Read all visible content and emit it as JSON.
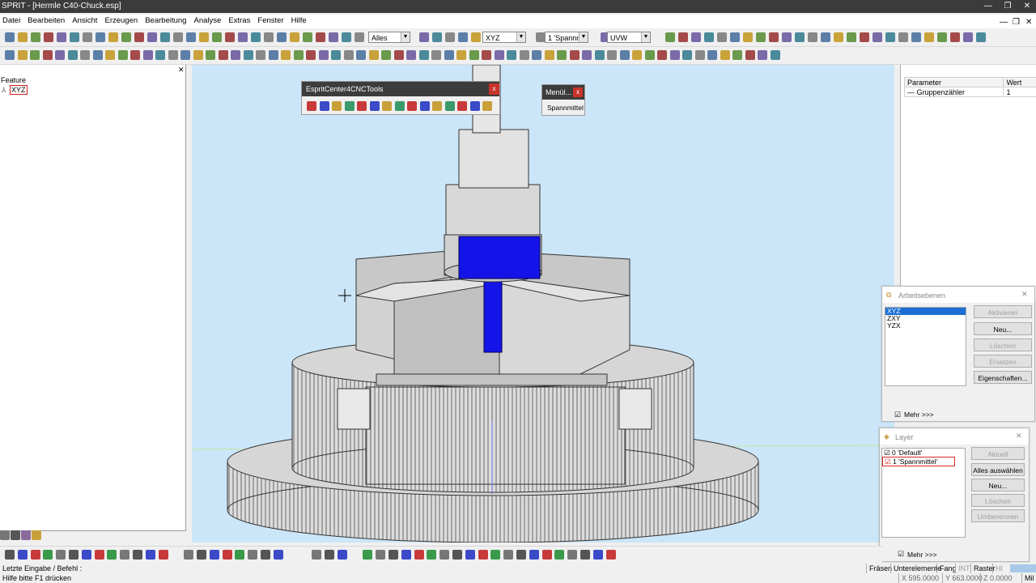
{
  "window": {
    "title": "SPRIT - [Hermle C40-Chuck.esp]",
    "buttons": [
      "—",
      "❐",
      "✕"
    ],
    "mdi_buttons": [
      "—",
      "❐",
      "✕"
    ]
  },
  "menu": [
    "Datei",
    "Bearbeiten",
    "Ansicht",
    "Erzeugen",
    "Bearbeitung",
    "Analyse",
    "Extras",
    "Fenster",
    "Hilfe"
  ],
  "toolbar": {
    "filter_combo": "Alles",
    "plane_combo": "XYZ",
    "layer_combo": "1 'Spannm",
    "uvw_combo": "UVW"
  },
  "feature_panel": {
    "title": "Feature",
    "tree_item": "XYZ",
    "close_glyph": "✕"
  },
  "tools_palette": {
    "title": "EspritCenter4CNCTools",
    "close_glyph": "x"
  },
  "menu_popup": {
    "title": "Menül...",
    "item": "Spannmittel",
    "close_glyph": "x"
  },
  "parameters": {
    "headers": [
      "Parameter",
      "Wert"
    ],
    "rows": [
      {
        "name": "Gruppenzähler",
        "value": "1"
      }
    ]
  },
  "work_planes": {
    "title": "Arbeitsebenen",
    "items": [
      "XYZ",
      "ZXY",
      "YZX"
    ],
    "selected": "XYZ",
    "buttons": [
      "Aktivieren",
      "Neu...",
      "Löschen",
      "Ersetzen",
      "Eigenschaften..."
    ],
    "more": "Mehr >>>"
  },
  "layers": {
    "title": "Layer",
    "items": [
      "0 'Default'",
      "1 'Spannmittel'"
    ],
    "buttons": [
      "Aktuell",
      "Alles auswählen",
      "Neu...",
      "Löschen",
      "Umbenennen"
    ],
    "more": "Mehr >>>"
  },
  "status": {
    "prompt": "Letzte Eingabe / Befehl :",
    "help": "Hilfe bitte F1 drücken",
    "modes": [
      "Fräsen",
      "Unterelemente",
      "Fang",
      "INT",
      "Raster",
      "HI"
    ],
    "x": "X 595.0000",
    "y": "Y 663.0000",
    "z": "Z 0.0000",
    "unit": "Mil"
  },
  "colors": {
    "viewport_bg": "#cbe6f8",
    "part_gray": "#d4d4d4",
    "workpiece_blue": "#1414e8",
    "layer_highlight": "#d8282a"
  }
}
